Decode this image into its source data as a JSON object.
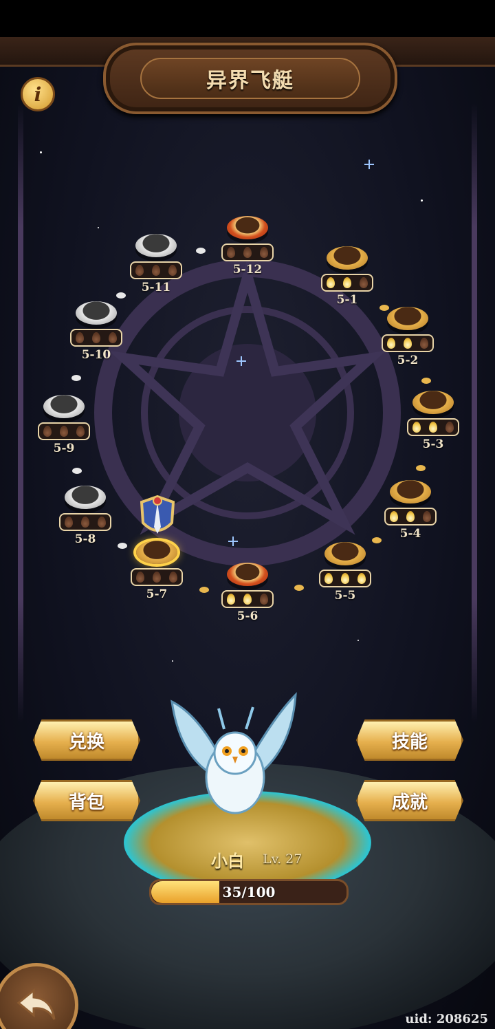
{
  "header": {
    "title": "异界飞艇",
    "info_icon": "i"
  },
  "stages": [
    {
      "label": "5-1",
      "state": "gold",
      "drops": [
        "gold",
        "gold",
        "brown"
      ]
    },
    {
      "label": "5-2",
      "state": "gold",
      "drops": [
        "gold",
        "gold",
        "brown"
      ]
    },
    {
      "label": "5-3",
      "state": "gold",
      "drops": [
        "gold",
        "gold",
        "brown"
      ]
    },
    {
      "label": "5-4",
      "state": "gold",
      "drops": [
        "gold",
        "gold",
        "brown"
      ]
    },
    {
      "label": "5-5",
      "state": "gold",
      "drops": [
        "gold",
        "gold",
        "gold"
      ]
    },
    {
      "label": "5-6",
      "state": "boss",
      "drops": [
        "gold",
        "gold",
        "brown"
      ]
    },
    {
      "label": "5-7",
      "state": "current",
      "drops": [
        "brown",
        "brown",
        "brown"
      ]
    },
    {
      "label": "5-8",
      "state": "locked",
      "drops": [
        "brown",
        "brown",
        "brown"
      ]
    },
    {
      "label": "5-9",
      "state": "locked",
      "drops": [
        "brown",
        "brown",
        "brown"
      ]
    },
    {
      "label": "5-10",
      "state": "locked",
      "drops": [
        "brown",
        "brown",
        "brown"
      ]
    },
    {
      "label": "5-11",
      "state": "locked",
      "drops": [
        "brown",
        "brown",
        "brown"
      ]
    },
    {
      "label": "5-12",
      "state": "boss-locked",
      "drops": [
        "brown",
        "brown",
        "brown"
      ]
    }
  ],
  "menu": {
    "exchange": "兑换",
    "bag": "背包",
    "skills": "技能",
    "achievements": "成就"
  },
  "pet": {
    "name": "小白",
    "level": "Lv. 27",
    "exp": "35/100",
    "exp_fraction": 0.35
  },
  "footer": {
    "uid": "uid: 208625"
  },
  "colors": {
    "gold": "#e6b04a",
    "accent_cyan": "#2ec4d0",
    "brown_frame": "#5e3a22"
  }
}
